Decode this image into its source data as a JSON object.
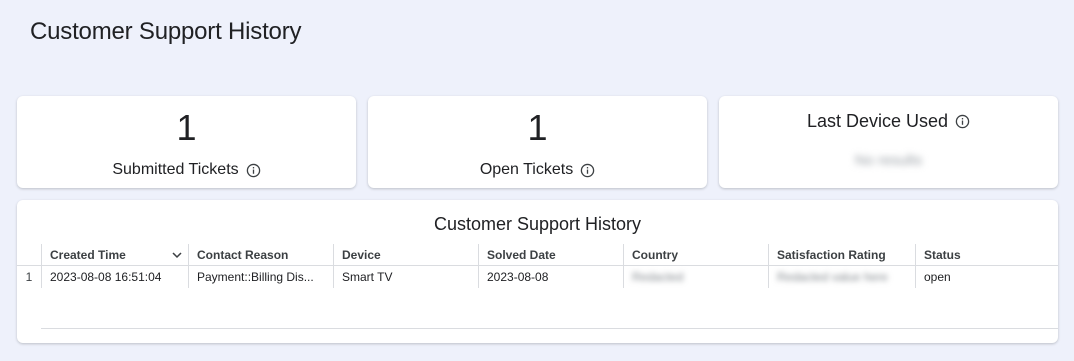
{
  "page_title": "Customer Support History",
  "kpis": [
    {
      "value": "1",
      "label": "Submitted Tickets",
      "icon": "info-icon"
    },
    {
      "value": "1",
      "label": "Open Tickets",
      "icon": "info-icon"
    },
    {
      "label": "Last Device Used",
      "value": "No results",
      "icon": "info-icon",
      "value_redacted": true
    }
  ],
  "table": {
    "title": "Customer Support History",
    "columns": [
      "Created Time",
      "Contact Reason",
      "Device",
      "Solved Date",
      "Country",
      "Satisfaction Rating",
      "Status"
    ],
    "sort_column": "Created Time",
    "sort_icon": "chevron-down-icon",
    "rows": [
      {
        "index": "1",
        "created_time": "2023-08-08 16:51:04",
        "contact_reason": "Payment::Billing Dis...",
        "device": "Smart TV",
        "solved_date": "2023-08-08",
        "country": "Redacted",
        "satisfaction_rating": "Redacted value here",
        "status": "open"
      }
    ]
  }
}
